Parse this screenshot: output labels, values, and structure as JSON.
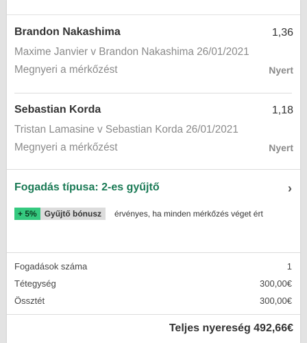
{
  "bets": [
    {
      "player": "Brandon Nakashima",
      "odds": "1,36",
      "match": "Maxime Janvier v Brandon Nakashima 26/01/2021",
      "market": "Megnyeri a mérkőzést",
      "result": "Nyert"
    },
    {
      "player": "Sebastian Korda",
      "odds": "1,18",
      "match": "Tristan Lamasine v Sebastian Korda 26/01/2021",
      "market": "Megnyeri a mérkőzést",
      "result": "Nyert"
    }
  ],
  "bet_type": "Fogadás típusa: 2-es gyűjtő",
  "bonus": {
    "percent": "+ 5%",
    "label": "Gyűjtő bónusz",
    "note": "érvényes, ha minden mérkőzés véget ért"
  },
  "summary": [
    {
      "label": "Fogadások száma",
      "value": "1"
    },
    {
      "label": "Tétegység",
      "value": "300,00€"
    },
    {
      "label": "Össztét",
      "value": "300,00€"
    }
  ],
  "total": "Teljes nyereség 492,66€",
  "colors": {
    "accent_green": "#1a7a55",
    "bonus_green": "#35c97f"
  },
  "icons": {
    "chevron": "chevron-right-icon"
  }
}
